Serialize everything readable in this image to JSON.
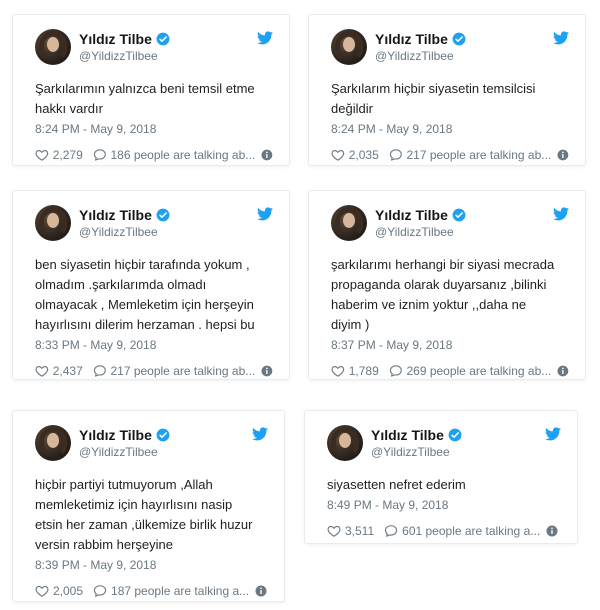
{
  "accent_color": "#1da1f2",
  "icons": {
    "verified": "verified-badge-icon",
    "bird": "twitter-bird-icon",
    "like": "heart-icon",
    "reply": "speech-bubble-icon",
    "info": "info-icon"
  },
  "tweets": [
    {
      "display_name": "Yıldız Tilbe",
      "handle": "@YildizzTilbee",
      "text": "Şarkılarımın yalnızca beni temsil etme\nhakkı vardır",
      "time": "8:24 PM - May 9, 2018",
      "likes": "2,279",
      "talking": "186 people are talking ab..."
    },
    {
      "display_name": "Yıldız Tilbe",
      "handle": "@YildizzTilbee",
      "text": "Şarkılarım hiçbir siyasetin temsilcisi\ndeğildir",
      "time": "8:24 PM - May 9, 2018",
      "likes": "2,035",
      "talking": "217 people are talking ab..."
    },
    {
      "display_name": "Yıldız Tilbe",
      "handle": "@YildizzTilbee",
      "text": "ben siyasetin hiçbir tarafında yokum ,\nolmadım .şarkılarımda olmadı\nolmayacak , Memleketim için herşeyin\nhayırlısını dilerim herzaman . hepsi bu",
      "time": "8:33 PM - May 9, 2018",
      "likes": "2,437",
      "talking": "217 people are talking ab..."
    },
    {
      "display_name": "Yıldız Tilbe",
      "handle": "@YildizzTilbee",
      "text": "şarkılarımı herhangi bir siyasi mecrada\npropaganda olarak duyarsanız ,bilinki\nhaberim ve iznim yoktur ,,daha ne\ndiyim )",
      "time": "8:37 PM - May 9, 2018",
      "likes": "1,789",
      "talking": "269 people are talking ab..."
    },
    {
      "display_name": "Yıldız Tilbe",
      "handle": "@YildizzTilbee",
      "text": "hiçbir partiyi tutmuyorum ,Allah\nmemleketimiz için hayırlısını nasip\netsin her zaman ,ülkemize birlik huzur\nversin rabbim herşeyine",
      "time": "8:39 PM - May 9, 2018",
      "likes": "2,005",
      "talking": "187 people are talking a..."
    },
    {
      "display_name": "Yıldız Tilbe",
      "handle": "@YildizzTilbee",
      "text": "siyasetten nefret ederim",
      "time": "8:49 PM - May 9, 2018",
      "likes": "3,511",
      "talking": "601 people are talking a..."
    }
  ]
}
